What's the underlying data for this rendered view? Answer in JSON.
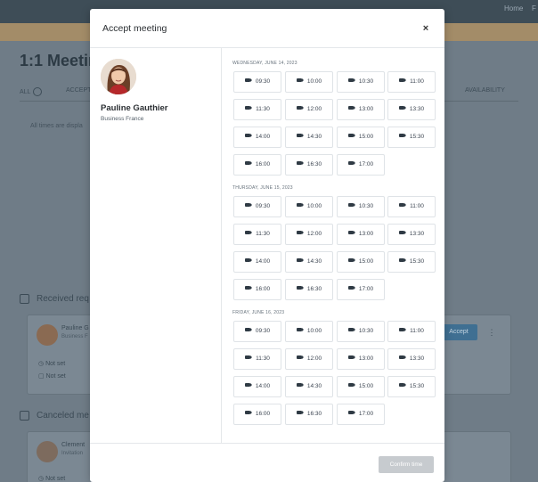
{
  "background": {
    "nav": [
      "Home",
      "F"
    ],
    "page_title": "1:1 Meetin",
    "tabs": [
      {
        "label": "ALL",
        "count": ""
      },
      {
        "label": "ACCEPT",
        "count": ""
      },
      {
        "label": "AVAILABILITY",
        "count": ""
      }
    ],
    "note": "All times are displa",
    "received_section": "Received req",
    "received_card": {
      "name": "Pauline G",
      "sub": "Business F",
      "time": "Not set",
      "date": "Not set",
      "accept_label": "Accept",
      "more_label": "⋮"
    },
    "canceled_section": "Canceled me",
    "canceled_card": {
      "name": "Clement",
      "sub": "Invitation",
      "time": "Not set"
    }
  },
  "modal": {
    "title": "Accept meeting",
    "close_label": "×",
    "host": {
      "name": "Pauline Gauthier",
      "company": "Business France"
    },
    "days": [
      {
        "label": "WEDNESDAY, JUNE 14, 2023",
        "slots": [
          "09:30",
          "10:00",
          "10:30",
          "11:00",
          "11:30",
          "12:00",
          "13:00",
          "13:30",
          "14:00",
          "14:30",
          "15:00",
          "15:30",
          "16:00",
          "16:30",
          "17:00"
        ]
      },
      {
        "label": "THURSDAY, JUNE 15, 2023",
        "slots": [
          "09:30",
          "10:00",
          "10:30",
          "11:00",
          "11:30",
          "12:00",
          "13:00",
          "13:30",
          "14:00",
          "14:30",
          "15:00",
          "15:30",
          "16:00",
          "16:30",
          "17:00"
        ]
      },
      {
        "label": "FRIDAY, JUNE 16, 2023",
        "slots": [
          "09:30",
          "10:00",
          "10:30",
          "11:00",
          "11:30",
          "12:00",
          "13:00",
          "13:30",
          "14:00",
          "14:30",
          "15:00",
          "15:30",
          "16:00",
          "16:30",
          "17:00"
        ]
      }
    ],
    "confirm_label": "Confirm time"
  },
  "colors": {
    "overlay": "#6d7a85",
    "accent_bar": "#a38c68",
    "confirm_disabled": "#c7cbcf",
    "accept_button": "#3f6f92"
  },
  "icons": {
    "slot": "video-camera-icon",
    "close": "close-icon",
    "time": "clock-icon",
    "date": "calendar-icon"
  }
}
